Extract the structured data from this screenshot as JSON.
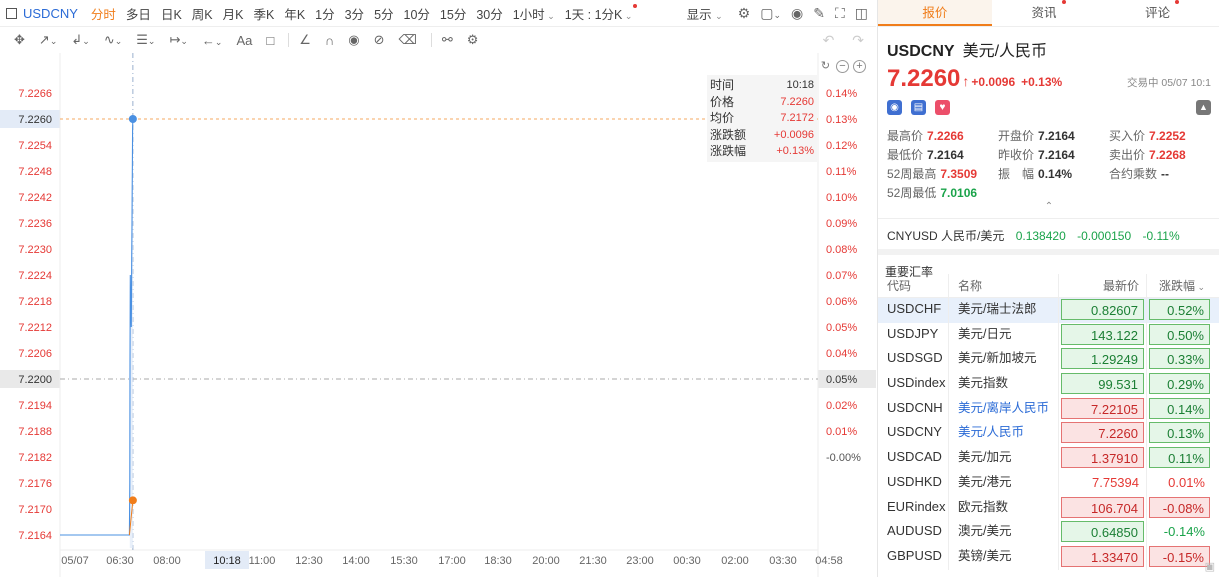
{
  "symbol_bar": {
    "symbol": "USDCNY",
    "timeframes": [
      {
        "label": "分时",
        "active": true
      },
      {
        "label": "多日"
      },
      {
        "label": "日K"
      },
      {
        "label": "周K"
      },
      {
        "label": "月K"
      },
      {
        "label": "季K"
      },
      {
        "label": "年K"
      },
      {
        "label": "1分"
      },
      {
        "label": "3分"
      },
      {
        "label": "5分"
      },
      {
        "label": "10分"
      },
      {
        "label": "15分"
      },
      {
        "label": "30分"
      },
      {
        "label": "1小时"
      },
      {
        "label": "1天 : 1分K"
      }
    ],
    "display_label": "显示"
  },
  "drawing_toolbar": {
    "text_tool": "Aa"
  },
  "tooltip": {
    "time_label": "时间",
    "time": "10:18",
    "price_label": "价格",
    "price": "7.2260",
    "avg_label": "均价",
    "avg": "7.2172",
    "chg_label": "涨跌额",
    "chg": "+0.0096",
    "pct_label": "涨跌幅",
    "pct": "+0.13%"
  },
  "chart_data": {
    "type": "line",
    "x_ticks": [
      "05/07",
      "06:30",
      "08:00",
      "10:18",
      "11:00",
      "12:30",
      "14:00",
      "15:30",
      "17:00",
      "18:30",
      "20:00",
      "21:30",
      "23:00",
      "00:30",
      "02:00",
      "03:30",
      "04:58"
    ],
    "y_ticks_left": [
      "7.2266",
      "7.2260",
      "7.2254",
      "7.2248",
      "7.2242",
      "7.2236",
      "7.2230",
      "7.2224",
      "7.2218",
      "7.2212",
      "7.2206",
      "7.2200",
      "7.2194",
      "7.2188",
      "7.2182",
      "7.2176",
      "7.2170",
      "7.2164"
    ],
    "y_ticks_right": [
      "0.14%",
      "0.13%",
      "0.12%",
      "0.11%",
      "0.10%",
      "0.09%",
      "0.08%",
      "0.07%",
      "0.06%",
      "0.05%",
      "0.04%",
      "0.03%",
      "0.02%",
      "0.01%",
      "-0.00%"
    ],
    "ylim": [
      7.2161,
      7.2269
    ],
    "prev_close": 7.2164,
    "crosshair_price": "7.2260",
    "crosshair_time": "10:18",
    "baseline_label": "7.2200",
    "baseline_pct": "0.05%",
    "series": [
      {
        "values": [
          [
            0,
            7.2164
          ],
          [
            130,
            7.2164
          ],
          [
            130.7,
            7.2176
          ],
          [
            131.2,
            7.2204
          ],
          [
            131.6,
            7.2224
          ],
          [
            132.0,
            7.222
          ],
          [
            132.4,
            7.2214
          ],
          [
            132.8,
            7.2213
          ],
          [
            133.2,
            7.2216
          ],
          [
            133.6,
            7.2212
          ],
          [
            134.0,
            7.2219
          ],
          [
            134.4,
            7.2228
          ],
          [
            134.8,
            7.2236
          ],
          [
            135.2,
            7.2244
          ],
          [
            135.6,
            7.225
          ],
          [
            136.0,
            7.2258
          ],
          [
            136.5,
            7.226
          ]
        ],
        "color": "#4a90e2"
      },
      {
        "values": [
          [
            130,
            7.2164
          ],
          [
            136.5,
            7.2172
          ]
        ],
        "color": "#f07d1a"
      }
    ],
    "x_range": [
      0,
      1418
    ]
  },
  "tabs": [
    {
      "label": "报价",
      "active": true
    },
    {
      "label": "资讯",
      "dot": true
    },
    {
      "label": "评论",
      "dot": true
    }
  ],
  "quote": {
    "symbol": "USDCNY",
    "name": "美元/人民币",
    "price": "7.2260",
    "change": "+0.0096",
    "change_pct": "+0.13%",
    "status": "交易中 05/07 10:1",
    "stats": [
      {
        "label": "最高价",
        "value": "7.2266",
        "color": "red"
      },
      {
        "label": "开盘价",
        "value": "7.2164",
        "color": "dark"
      },
      {
        "label": "买入价",
        "value": "7.2252",
        "color": "red"
      },
      {
        "label": "最低价",
        "value": "7.2164",
        "color": "dark"
      },
      {
        "label": "昨收价",
        "value": "7.2164",
        "color": "dark"
      },
      {
        "label": "卖出价",
        "value": "7.2268",
        "color": "red"
      },
      {
        "label": "52周最高",
        "value": "7.3509",
        "color": "red"
      },
      {
        "label": "振　幅",
        "value": "0.14%",
        "color": "dark"
      },
      {
        "label": "合约乘数",
        "value": "--",
        "color": "dark"
      },
      {
        "label": "52周最低",
        "value": "7.0106",
        "color": "green"
      }
    ]
  },
  "cross_rate": {
    "name": "CNYUSD 人民币/美元",
    "price": "0.138420",
    "change": "-0.000150",
    "pct": "-0.11%"
  },
  "section_title": "重要汇率",
  "rates_table": {
    "headers": [
      "代码",
      "名称",
      "最新价",
      "涨跌幅"
    ],
    "rows": [
      {
        "code": "USDCHF",
        "name": "美元/瑞士法郎",
        "price": "0.82607",
        "pct": "0.52%",
        "style": "dn",
        "selected": true
      },
      {
        "code": "USDJPY",
        "name": "美元/日元",
        "price": "143.122",
        "pct": "0.50%",
        "style": "dn"
      },
      {
        "code": "USDSGD",
        "name": "美元/新加坡元",
        "price": "1.29249",
        "pct": "0.33%",
        "style": "dn"
      },
      {
        "code": "USDindex",
        "name": "美元指数",
        "price": "99.531",
        "pct": "0.29%",
        "style": "dn"
      },
      {
        "code": "USDCNH",
        "name": "美元/离岸人民币",
        "price": "7.22105",
        "pct": "0.14%",
        "style": "up",
        "link": true
      },
      {
        "code": "USDCNY",
        "name": "美元/人民币",
        "price": "7.2260",
        "pct": "0.13%",
        "style": "up",
        "link": true
      },
      {
        "code": "USDCAD",
        "name": "美元/加元",
        "price": "1.37910",
        "pct": "0.11%",
        "style": "up"
      },
      {
        "code": "USDHKD",
        "name": "美元/港元",
        "price": "7.75394",
        "pct": "0.01%",
        "style": "plainred"
      },
      {
        "code": "EURindex",
        "name": "欧元指数",
        "price": "106.704",
        "pct": "-0.08%",
        "style": "up"
      },
      {
        "code": "AUDUSD",
        "name": "澳元/美元",
        "price": "0.64850",
        "pct": "-0.14%",
        "style": "dn"
      },
      {
        "code": "GBPUSD",
        "name": "英镑/美元",
        "price": "1.33470",
        "pct": "-0.15%",
        "style": "up"
      }
    ]
  },
  "colors": {
    "accent": "#f07d1a",
    "up": "#e53935",
    "down": "#1aa34a",
    "link": "#2b6bd6"
  }
}
